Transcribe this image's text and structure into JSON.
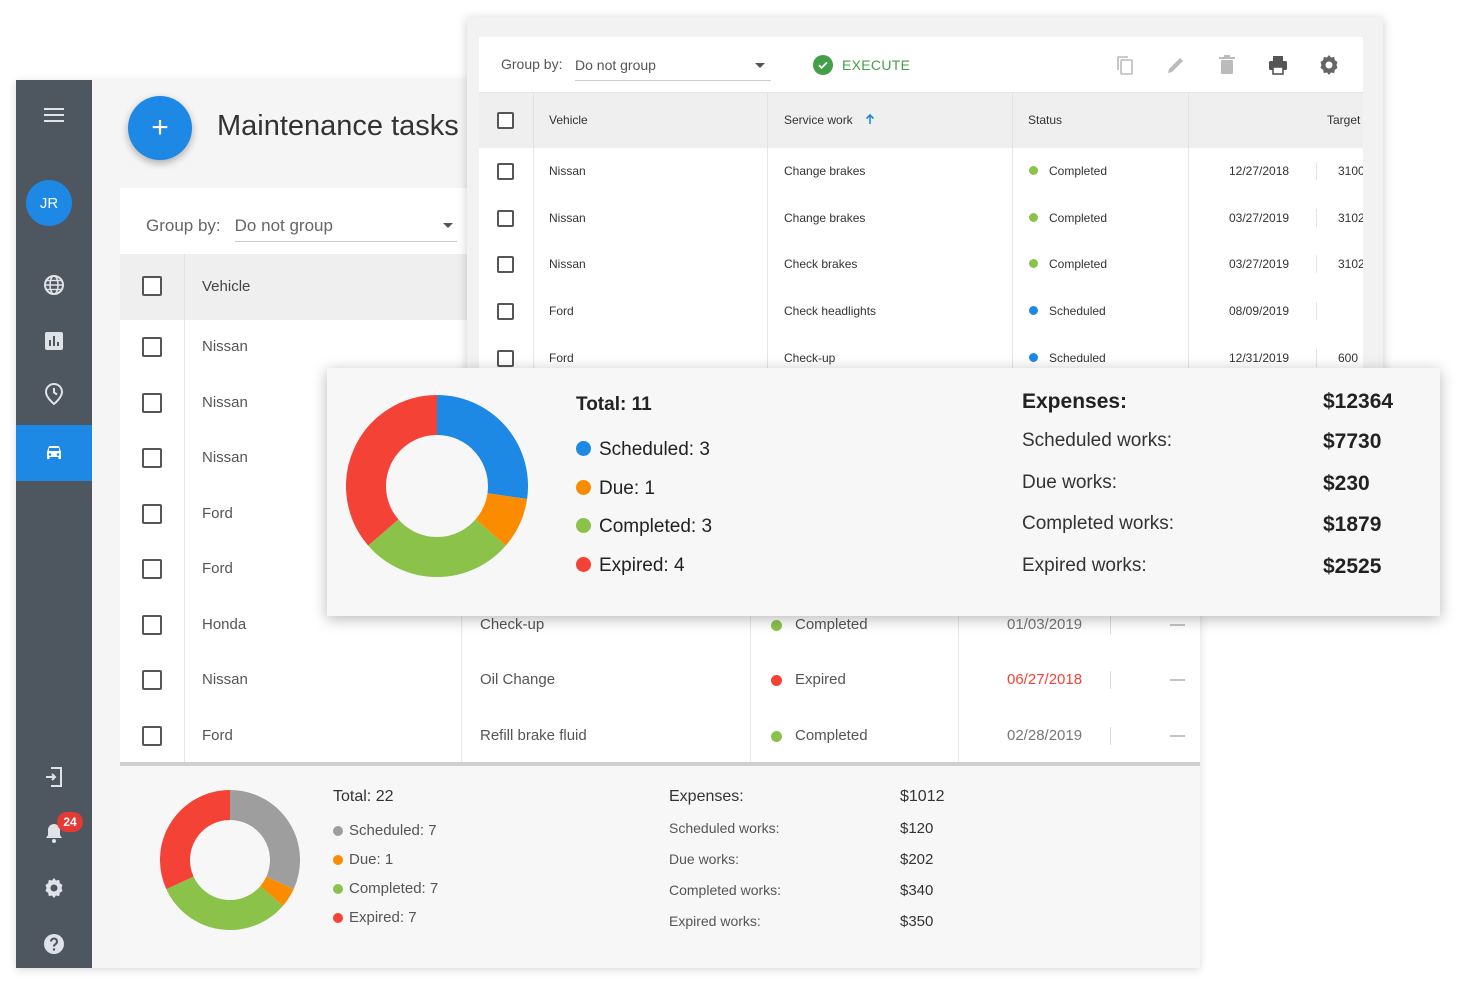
{
  "app": {
    "title": "Maintenance tasks",
    "avatar_initials": "JR",
    "notification_count": "24",
    "add_label": "+"
  },
  "colors": {
    "accent": "#1e88e5",
    "scheduled": "#1e88e5",
    "due": "#fb8c00",
    "completed": "#8bc34a",
    "expired": "#f44336",
    "scheduled_gray": "#9e9e9e",
    "execute": "#43a047",
    "sidebar": "#4e5660"
  },
  "sidebar": {
    "items": [
      {
        "icon": "menu-icon"
      },
      {
        "icon": "globe-icon"
      },
      {
        "icon": "bar-chart-icon"
      },
      {
        "icon": "clock-pin-icon"
      },
      {
        "icon": "car-icon",
        "active": true
      },
      {
        "icon": "logout-icon"
      },
      {
        "icon": "bell-icon"
      },
      {
        "icon": "gear-icon"
      },
      {
        "icon": "help-icon"
      }
    ]
  },
  "back_table": {
    "group_label": "Group by:",
    "group_value": "Do not group",
    "header_vehicle": "Vehicle",
    "rows": [
      {
        "vehicle": "Nissan"
      },
      {
        "vehicle": "Nissan"
      },
      {
        "vehicle": "Nissan"
      },
      {
        "vehicle": "Ford"
      },
      {
        "vehicle": "Ford"
      },
      {
        "vehicle": "Honda",
        "service": "Check-up",
        "status": "Completed",
        "status_color": "completed",
        "date": "01/03/2019",
        "date_color": "#777777",
        "target": "—"
      },
      {
        "vehicle": "Nissan",
        "service": "Oil Change",
        "status": "Expired",
        "status_color": "expired",
        "date": "06/27/2018",
        "date_color": "#f44336",
        "target": "—"
      },
      {
        "vehicle": "Ford",
        "service": "Refill brake fluid",
        "status": "Completed",
        "status_color": "completed",
        "date": "02/28/2019",
        "date_color": "#777777",
        "target": "—"
      }
    ]
  },
  "back_summary": {
    "total": "Total: 22",
    "legend": [
      {
        "label": "Scheduled: 7",
        "color": "scheduled_gray",
        "value": 7
      },
      {
        "label": "Due: 1",
        "color": "due",
        "value": 1
      },
      {
        "label": "Completed: 7",
        "color": "completed",
        "value": 7
      },
      {
        "label": "Expired: 7",
        "color": "expired",
        "value": 7
      }
    ],
    "expenses_label": "Expenses:",
    "expenses_value": "$1012",
    "breakdown": [
      {
        "label": "Scheduled works:",
        "value": "$120"
      },
      {
        "label": "Due works:",
        "value": "$202"
      },
      {
        "label": "Completed works:",
        "value": "$340"
      },
      {
        "label": "Expired works:",
        "value": "$350"
      }
    ]
  },
  "top_table": {
    "group_label": "Group by:",
    "group_value": "Do not group",
    "execute_label": "EXECUTE",
    "tools": [
      "copy-icon",
      "edit-icon",
      "delete-icon",
      "print-icon",
      "settings-icon"
    ],
    "headers": {
      "vehicle": "Vehicle",
      "service": "Service work",
      "status": "Status",
      "target": "Target"
    },
    "rows": [
      {
        "vehicle": "Nissan",
        "service": "Change brakes",
        "status": "Completed",
        "status_color": "completed",
        "date": "12/27/2018",
        "target": "3100"
      },
      {
        "vehicle": "Nissan",
        "service": "Change brakes",
        "status": "Completed",
        "status_color": "completed",
        "date": "03/27/2019",
        "target": "3102"
      },
      {
        "vehicle": "Nissan",
        "service": "Check brakes",
        "status": "Completed",
        "status_color": "completed",
        "date": "03/27/2019",
        "target": "3102"
      },
      {
        "vehicle": "Ford",
        "service": "Check headlights",
        "status": "Scheduled",
        "status_color": "scheduled",
        "date": "08/09/2019",
        "target": ""
      },
      {
        "vehicle": "Ford",
        "service": "Check-up",
        "status": "Scheduled",
        "status_color": "scheduled",
        "date": "12/31/2019",
        "target": "600"
      }
    ]
  },
  "popup": {
    "total": "Total: 11",
    "legend": [
      {
        "label": "Scheduled: 3",
        "color": "scheduled",
        "value": 3
      },
      {
        "label": "Due: 1",
        "color": "due",
        "value": 1
      },
      {
        "label": "Completed: 3",
        "color": "completed",
        "value": 3
      },
      {
        "label": "Expired: 4",
        "color": "expired",
        "value": 4
      }
    ],
    "expenses_label": "Expenses:",
    "expenses_value": "$12364",
    "breakdown": [
      {
        "label": "Scheduled works:",
        "value": "$7730"
      },
      {
        "label": "Due works:",
        "value": "$230"
      },
      {
        "label": "Completed works:",
        "value": "$1879"
      },
      {
        "label": "Expired works:",
        "value": "$2525"
      }
    ]
  }
}
